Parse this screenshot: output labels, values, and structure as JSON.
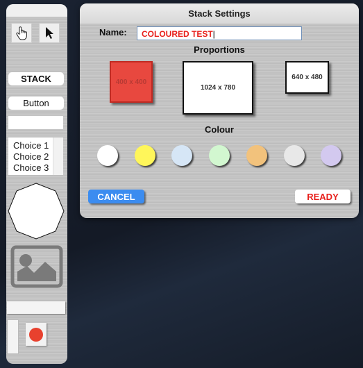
{
  "palette": {
    "tools": [
      {
        "icon": "hand-pointer-icon"
      },
      {
        "icon": "arrow-pointer-icon"
      }
    ],
    "stack_label": "STACK",
    "button_label": "Button",
    "field_value": "",
    "list_items": [
      "Choice 1",
      "Choice 2",
      "Choice 3"
    ],
    "record_color": "#e8412e"
  },
  "dialog": {
    "title": "Stack Settings",
    "name_label": "Name:",
    "name_value": "COLOURED TEST",
    "proportions_label": "Proportions",
    "proportions": [
      {
        "label": "400 x 400",
        "selected": true,
        "color": "#e8483f"
      },
      {
        "label": "1024 x 780",
        "selected": false,
        "color": "#ffffff"
      },
      {
        "label": "640 x 480",
        "selected": false,
        "color": "#ffffff"
      }
    ],
    "colour_label": "Colour",
    "colours": [
      "#ffffff",
      "#fff65a",
      "#d6e6f6",
      "#d2f7d0",
      "#f2c27c",
      "#e8e8e8",
      "#d3c9ef"
    ],
    "cancel_label": "CANCEL",
    "ready_label": "READY",
    "accent": "#e8201c",
    "cancel_color": "#3b8cf0"
  }
}
